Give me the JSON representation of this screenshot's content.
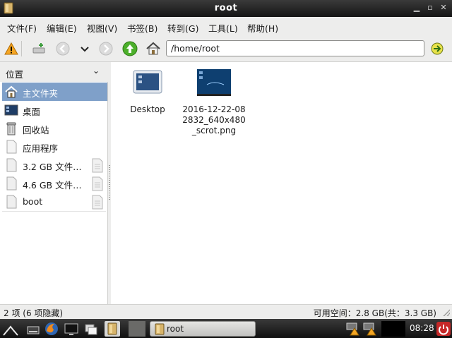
{
  "window": {
    "title": "root"
  },
  "menu": [
    "文件(F)",
    "编辑(E)",
    "视图(V)",
    "书签(B)",
    "转到(G)",
    "工具(L)",
    "帮助(H)"
  ],
  "toolbar": {
    "icons": [
      "warning-icon",
      "new-tab-icon",
      "back-icon",
      "history-dropdown-icon",
      "forward-icon",
      "up-icon",
      "home-icon",
      "go-icon"
    ],
    "path": "/home/root"
  },
  "sidebar": {
    "header": "位置",
    "items": [
      {
        "label": "主文件夹",
        "icon": "home-icon",
        "selected": true
      },
      {
        "label": "桌面",
        "icon": "desktop-icon"
      },
      {
        "label": "回收站",
        "icon": "trash-icon"
      },
      {
        "label": "应用程序",
        "icon": "applications-icon"
      },
      {
        "label": "3.2 GB 文件…",
        "icon": "drive-icon",
        "ejectable": true
      },
      {
        "label": "4.6 GB 文件…",
        "icon": "drive-icon",
        "ejectable": true
      },
      {
        "label": "boot",
        "icon": "drive-icon",
        "ejectable": true
      }
    ]
  },
  "files": [
    {
      "name": "Desktop",
      "icon": "folder-desktop-icon"
    },
    {
      "name": "2016-12-22-08\n2832_640x480\n_scrot.png",
      "icon": "image-thumbnail-icon"
    }
  ],
  "status": {
    "left": "2 项 (6 项隐藏)",
    "right": "可用空间：2.8 GB(共：3.3 GB)"
  },
  "taskbar": {
    "window_button": "root",
    "clock": "08:28"
  },
  "colors": {
    "selection": "#7fa0c9",
    "panel": "#ededec",
    "taskbar": "#1e1e1e"
  }
}
